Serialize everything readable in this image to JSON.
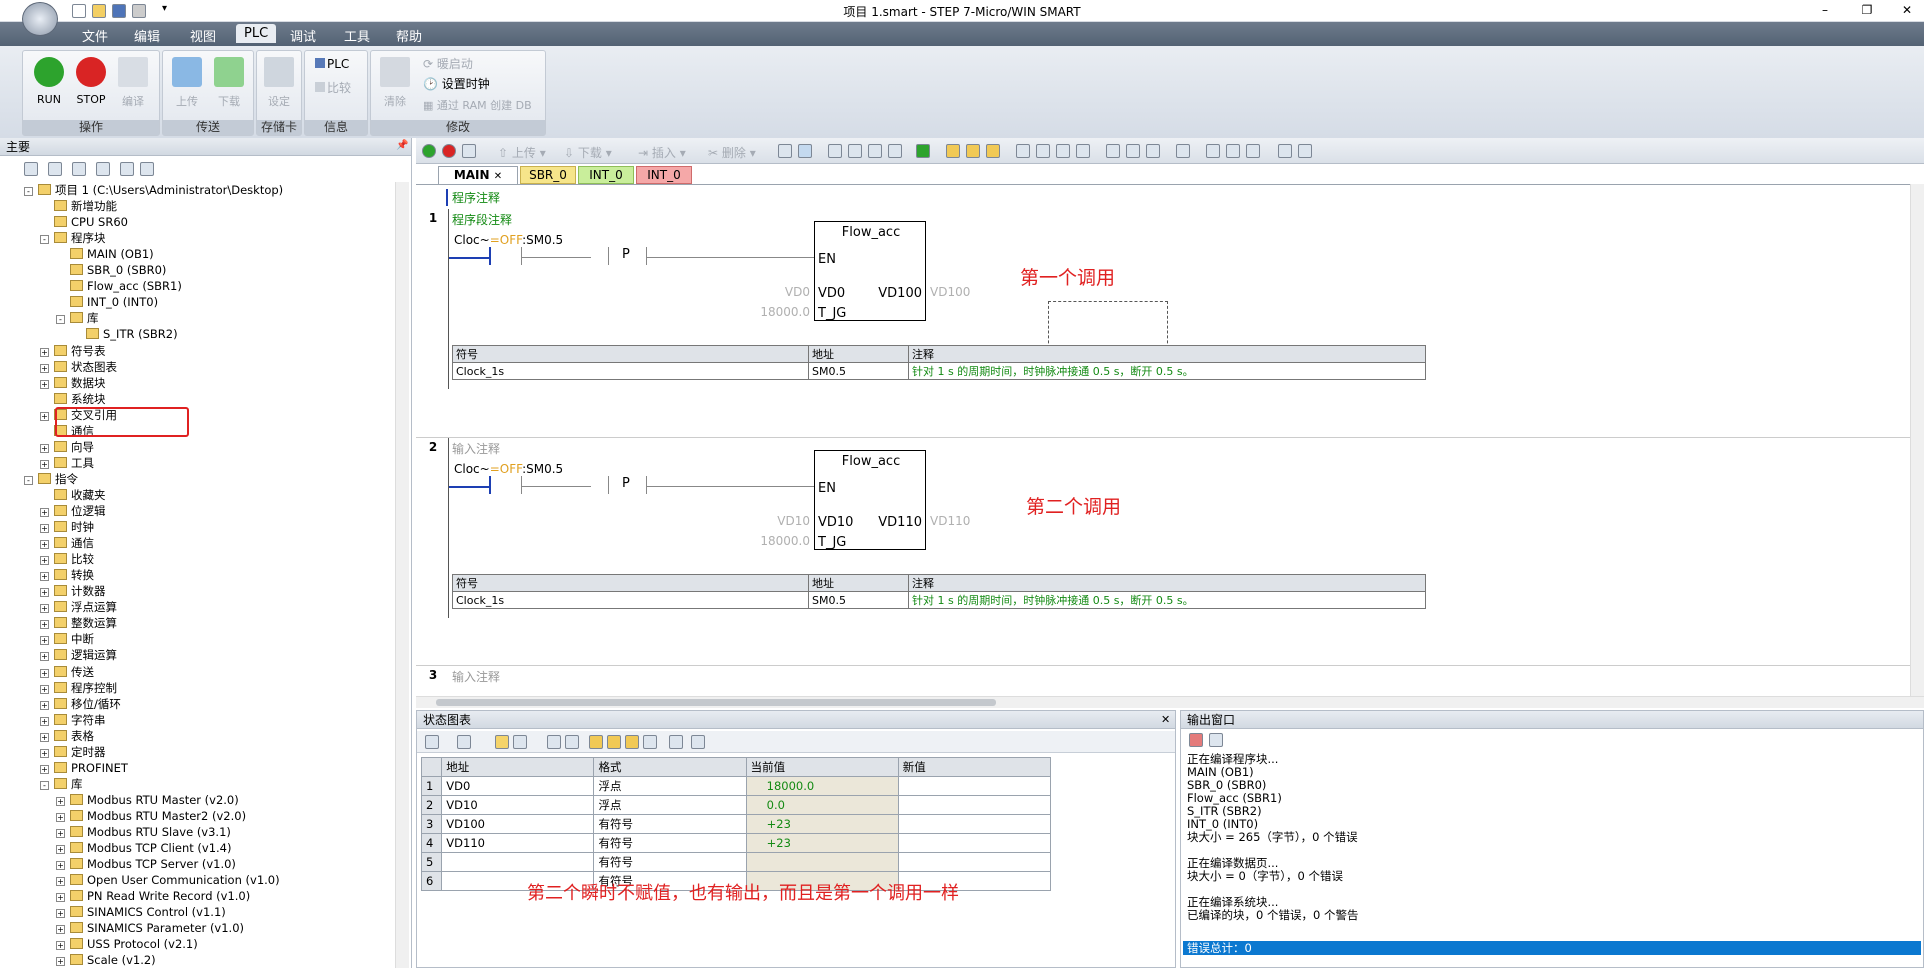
{
  "window": {
    "title": "项目 1.smart - STEP 7-Micro/WIN SMART"
  },
  "menu": [
    "文件",
    "编辑",
    "视图",
    "PLC",
    "调试",
    "工具",
    "帮助"
  ],
  "ribbon": {
    "run": "RUN",
    "stop": "STOP",
    "compile": "编译",
    "upload": "上传",
    "download": "下载",
    "setup": "设定",
    "plc": "PLC",
    "compare": "比较",
    "clear": "清除",
    "warm_start": "暖启动",
    "set_clock": "设置时钟",
    "ram_db": "通过 RAM 创建 DB",
    "groups": [
      "操作",
      "传送",
      "存储卡",
      "信息",
      "修改"
    ]
  },
  "nav": {
    "title": "主要",
    "items": [
      {
        "label": "项目 1 (C:\\Users\\Administrator\\Desktop)"
      },
      {
        "label": "新增功能"
      },
      {
        "label": "CPU SR60"
      },
      {
        "label": "程序块"
      },
      {
        "label": "MAIN (OB1)"
      },
      {
        "label": "SBR_0 (SBR0)"
      },
      {
        "label": "Flow_acc (SBR1)"
      },
      {
        "label": "INT_0 (INT0)"
      },
      {
        "label": "库"
      },
      {
        "label": "S_ITR (SBR2)"
      },
      {
        "label": "符号表"
      },
      {
        "label": "状态图表"
      },
      {
        "label": "数据块"
      },
      {
        "label": "系统块"
      },
      {
        "label": "交叉引用"
      },
      {
        "label": "通信"
      },
      {
        "label": "向导"
      },
      {
        "label": "工具"
      },
      {
        "label": "指令"
      },
      {
        "label": "收藏夹"
      },
      {
        "label": "位逻辑"
      },
      {
        "label": "时钟"
      },
      {
        "label": "通信"
      },
      {
        "label": "比较"
      },
      {
        "label": "转换"
      },
      {
        "label": "计数器"
      },
      {
        "label": "浮点运算"
      },
      {
        "label": "整数运算"
      },
      {
        "label": "中断"
      },
      {
        "label": "逻辑运算"
      },
      {
        "label": "传送"
      },
      {
        "label": "程序控制"
      },
      {
        "label": "移位/循环"
      },
      {
        "label": "字符串"
      },
      {
        "label": "表格"
      },
      {
        "label": "定时器"
      },
      {
        "label": "PROFINET"
      },
      {
        "label": "库"
      },
      {
        "label": "Modbus RTU Master (v2.0)"
      },
      {
        "label": "Modbus RTU Master2 (v2.0)"
      },
      {
        "label": "Modbus RTU Slave (v3.1)"
      },
      {
        "label": "Modbus TCP Client (v1.4)"
      },
      {
        "label": "Modbus TCP Server (v1.0)"
      },
      {
        "label": "Open User Communication (v1.0)"
      },
      {
        "label": "PN Read Write Record (v1.0)"
      },
      {
        "label": "SINAMICS Control (v1.1)"
      },
      {
        "label": "SINAMICS Parameter (v1.0)"
      },
      {
        "label": "USS Protocol (v2.1)"
      },
      {
        "label": "Scale (v1.2)"
      }
    ]
  },
  "editor": {
    "toolbar": {
      "upload": "上传",
      "download": "下载",
      "insert": "插入",
      "delete": "删除"
    },
    "tabs": [
      "MAIN",
      "SBR_0",
      "INT_0",
      "INT_0"
    ],
    "program_comment": "程序注释",
    "networks": [
      {
        "num": "1",
        "comment": "程序段注释",
        "contact": "Cloc~=OFF:SM0.5",
        "p_label": "P",
        "block": "Flow_acc",
        "en": "EN",
        "in1_pin": "VD0",
        "in1_ext": "VD0",
        "in2_pin": "T_JG",
        "in2_ext": "18000.0",
        "out_pin": "VD100",
        "out_ext": "VD100",
        "annotation": "第一个调用",
        "table": {
          "headers": [
            "符号",
            "地址",
            "注释"
          ],
          "row": [
            "Clock_1s",
            "SM0.5",
            "针对 1 s 的周期时间，时钟脉冲接通 0.5 s，断开 0.5 s。"
          ]
        }
      },
      {
        "num": "2",
        "comment": "输入注释",
        "contact": "Cloc~=OFF:SM0.5",
        "p_label": "P",
        "block": "Flow_acc",
        "en": "EN",
        "in1_pin": "VD10",
        "in1_ext": "VD10",
        "in2_pin": "T_JG",
        "in2_ext": "18000.0",
        "out_pin": "VD110",
        "out_ext": "VD110",
        "annotation": "第二个调用",
        "table": {
          "headers": [
            "符号",
            "地址",
            "注释"
          ],
          "row": [
            "Clock_1s",
            "SM0.5",
            "针对 1 s 的周期时间，时钟脉冲接通 0.5 s，断开 0.5 s。"
          ]
        }
      },
      {
        "num": "3",
        "comment": "输入注释"
      }
    ]
  },
  "status_chart": {
    "title": "状态图表",
    "headers": [
      "",
      "地址",
      "格式",
      "当前值",
      "新值"
    ],
    "rows": [
      [
        "1",
        "VD0",
        "浮点",
        "18000.0",
        ""
      ],
      [
        "2",
        "VD10",
        "浮点",
        "0.0",
        ""
      ],
      [
        "3",
        "VD100",
        "有符号",
        "+23",
        ""
      ],
      [
        "4",
        "VD110",
        "有符号",
        "+23",
        ""
      ],
      [
        "5",
        "",
        "有符号",
        "",
        ""
      ],
      [
        "6",
        "",
        "有符号",
        "",
        ""
      ]
    ],
    "annotation": "第二个瞬时不赋值，也有输出，而且是第一个调用一样"
  },
  "output": {
    "title": "输出窗口",
    "lines": [
      "正在编译程序块...",
      "MAIN (OB1)",
      "SBR_0 (SBR0)",
      "Flow_acc (SBR1)",
      "S_ITR (SBR2)",
      "INT_0 (INT0)",
      "块大小 = 265（字节），0 个错误",
      "",
      "正在编译数据页...",
      "块大小 = 0（字节），0 个错误",
      "",
      "正在编译系统块...",
      "已编译的块，0 个错误，0 个警告"
    ],
    "error_total": "错误总计：0"
  }
}
